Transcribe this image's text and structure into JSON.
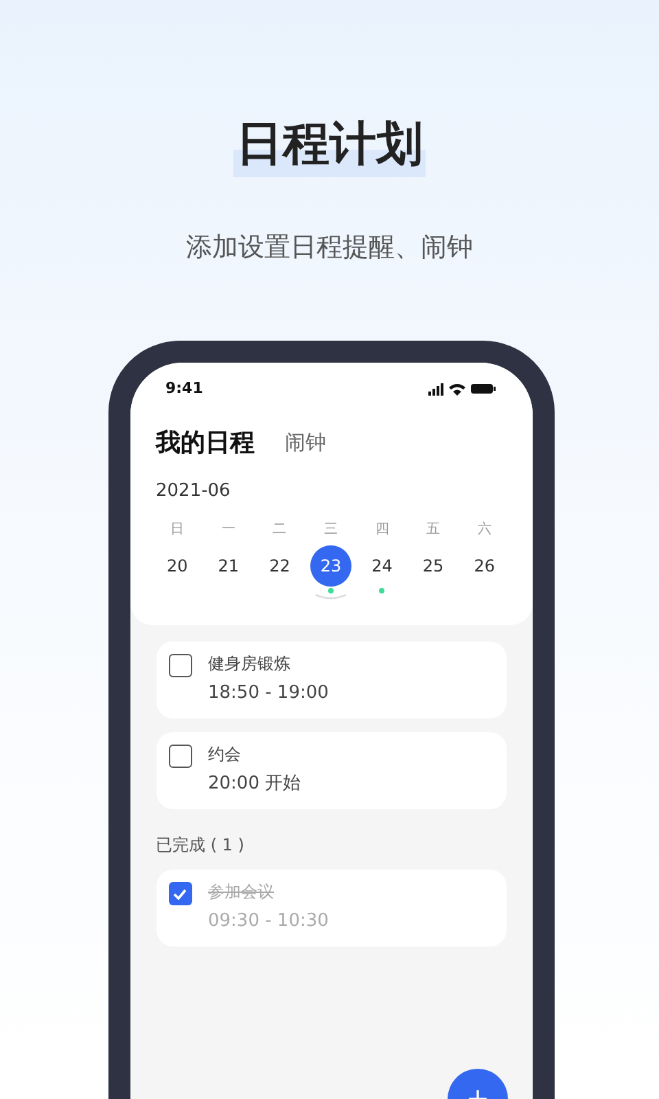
{
  "headline": "日程计划",
  "subtitle": "添加设置日程提醒、闹钟",
  "phone": {
    "status_bar": {
      "time": "9:41"
    },
    "tabs": [
      {
        "label": "我的日程",
        "selected": true
      },
      {
        "label": "闹钟",
        "selected": false
      }
    ],
    "month": "2021-06",
    "weekdays": [
      "日",
      "一",
      "二",
      "三",
      "四",
      "五",
      "六"
    ],
    "dates": [
      {
        "label": "20",
        "selected": false,
        "has_event": false
      },
      {
        "label": "21",
        "selected": false,
        "has_event": false
      },
      {
        "label": "22",
        "selected": false,
        "has_event": false
      },
      {
        "label": "23",
        "selected": true,
        "has_event": true
      },
      {
        "label": "24",
        "selected": false,
        "has_event": true
      },
      {
        "label": "25",
        "selected": false,
        "has_event": false
      },
      {
        "label": "26",
        "selected": false,
        "has_event": false
      }
    ],
    "tasks": [
      {
        "title": "健身房锻炼",
        "time": "18:50 - 19:00",
        "checked": false
      },
      {
        "title": "约会",
        "time": "20:00 开始",
        "checked": false
      }
    ],
    "completed": {
      "label": "已完成 ( 1 )",
      "tasks": [
        {
          "title": "参加会议",
          "time": "09:30 - 10:30",
          "checked": true
        }
      ]
    }
  }
}
